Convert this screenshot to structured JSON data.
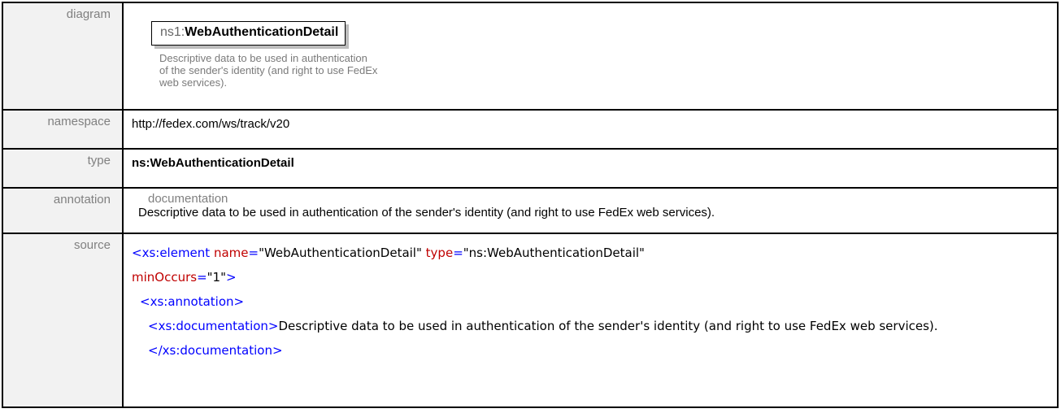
{
  "rows": {
    "diagram": {
      "label": "diagram",
      "element_prefix": "ns1:",
      "element_name": "WebAuthenticationDetail",
      "description": "Descriptive data to be used in authentication of the sender's identity (and right to use FedEx web services)."
    },
    "namespace": {
      "label": "namespace",
      "value": "http://fedex.com/ws/track/v20"
    },
    "type": {
      "label": "type",
      "value": "ns:WebAuthenticationDetail"
    },
    "annotation": {
      "label": "annotation",
      "heading": "documentation",
      "text": "Descriptive data to be used in authentication of the sender's identity (and right to use FedEx web services)."
    },
    "source": {
      "label": "source",
      "line1_open": "<xs:element",
      "attr_name": "name",
      "eq1": "=",
      "val_name": "\"WebAuthenticationDetail\"",
      "attr_type": "type",
      "eq2": "=",
      "val_type": "\"ns:WebAuthenticationDetail\"",
      "attr_min": "minOccurs",
      "eq3": "=",
      "val_min": "\"1\"",
      "close1": ">",
      "annotation_open": "<xs:annotation>",
      "doc_open": "<xs:documentation>",
      "doc_text": "Descriptive data to be used in authentication of the sender's identity (and right to use FedEx web services).",
      "doc_close": "</xs:documentation>"
    }
  }
}
